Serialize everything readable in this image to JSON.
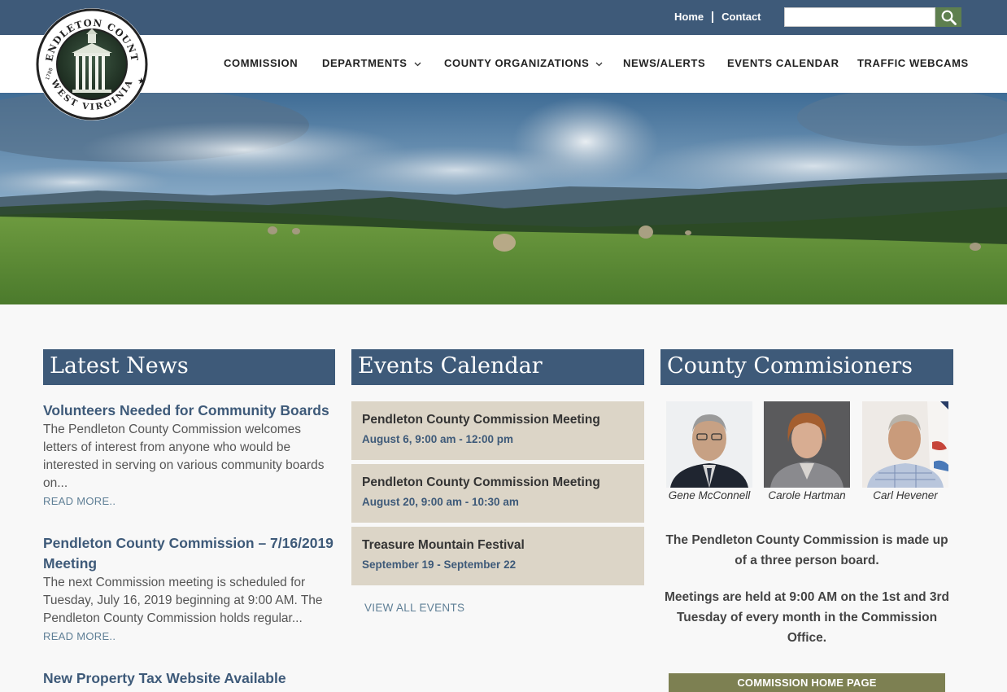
{
  "topbar": {
    "links": [
      {
        "label": "Home"
      },
      {
        "label": "Contact"
      }
    ],
    "search": {
      "value": "",
      "placeholder": ""
    }
  },
  "seal": {
    "text_top": "PENDLETON COUNTY",
    "text_bottom": "WEST VIRGINIA",
    "year": "1788"
  },
  "nav": [
    {
      "label": "COMMISSION",
      "dropdown": false
    },
    {
      "label": "DEPARTMENTS",
      "dropdown": true
    },
    {
      "label": "COUNTY ORGANIZATIONS",
      "dropdown": true
    },
    {
      "label": "NEWS/ALERTS",
      "dropdown": false
    },
    {
      "label": "EVENTS CALENDAR",
      "dropdown": false
    },
    {
      "label": "TRAFFIC WEBCAMS",
      "dropdown": false
    }
  ],
  "news": {
    "heading": "Latest News",
    "items": [
      {
        "title": "Volunteers Needed for Community Boards",
        "body": "The Pendleton County Commission welcomes letters of interest from anyone who would be interested in serving on various community boards on...",
        "more": "READ MORE.."
      },
      {
        "title": "Pendleton County Commission – 7/16/2019 Meeting",
        "body": "The next Commission meeting is scheduled for Tuesday, July 16, 2019 beginning at 9:00 AM. The Pendleton County Commission holds regular...",
        "more": "READ MORE.."
      },
      {
        "title": "New Property Tax Website Available",
        "body": "",
        "more": ""
      }
    ]
  },
  "events": {
    "heading": "Events Calendar",
    "items": [
      {
        "title": "Pendleton County Commission Meeting",
        "date": "August 6, 9:00 am - 12:00 pm"
      },
      {
        "title": "Pendleton County Commission Meeting",
        "date": "August 20, 9:00 am - 10:30 am"
      },
      {
        "title": "Treasure Mountain Festival",
        "date": "September 19 - September 22"
      }
    ],
    "view_all": "VIEW ALL EVENTS"
  },
  "commissioners": {
    "heading": "County Commisioners",
    "people": [
      {
        "name": "Gene McConnell"
      },
      {
        "name": "Carole Hartman"
      },
      {
        "name": "Carl Hevener"
      }
    ],
    "description": "The Pendleton County Commission is made up of a three person board.",
    "meetings": "Meetings are held at 9:00 AM on the 1st and 3rd Tuesday of every month in the Commission Office.",
    "home_button": "COMMISSION HOME PAGE"
  },
  "colors": {
    "brand_blue": "#3e5a79",
    "search_green": "#5e7f4f",
    "event_card": "#dcd5c7",
    "olive_button": "#7d8052",
    "link_blue": "#5f7f96"
  }
}
